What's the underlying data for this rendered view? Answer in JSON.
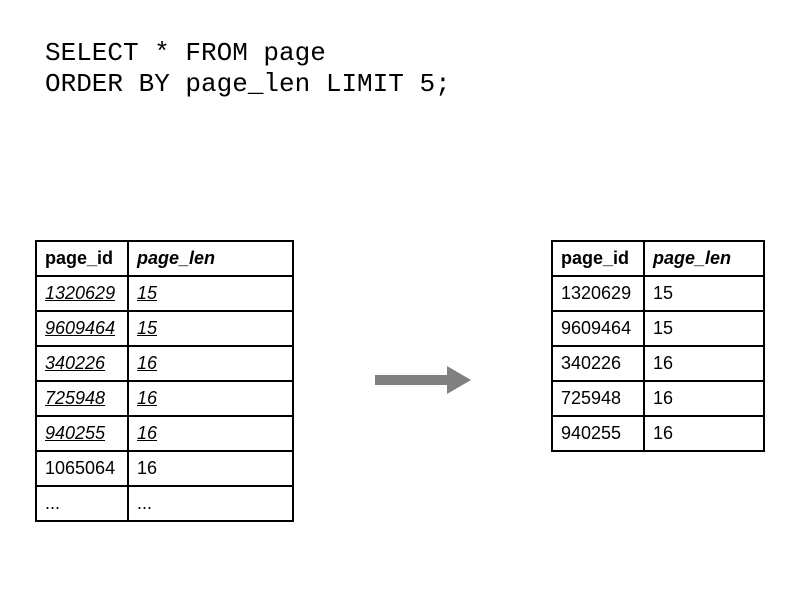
{
  "sql": {
    "line1": "SELECT * FROM page",
    "line2": "ORDER BY page_len LIMIT 5;"
  },
  "left_table": {
    "headers": {
      "id": "page_id",
      "len": "page_len"
    },
    "rows": [
      {
        "id": "1320629",
        "len": "15",
        "hl": true
      },
      {
        "id": "9609464",
        "len": "15",
        "hl": true
      },
      {
        "id": "340226",
        "len": "16",
        "hl": true
      },
      {
        "id": "725948",
        "len": "16",
        "hl": true
      },
      {
        "id": "940255",
        "len": "16",
        "hl": true
      },
      {
        "id": "1065064",
        "len": "16",
        "hl": false
      },
      {
        "id": "...",
        "len": "...",
        "hl": false
      }
    ]
  },
  "right_table": {
    "headers": {
      "id": "page_id",
      "len": "page_len"
    },
    "rows": [
      {
        "id": "1320629",
        "len": "15"
      },
      {
        "id": "9609464",
        "len": "15"
      },
      {
        "id": "340226",
        "len": "16"
      },
      {
        "id": "725948",
        "len": "16"
      },
      {
        "id": "940255",
        "len": "16"
      }
    ]
  },
  "chart_data": {
    "type": "table",
    "title": "SQL LIMIT illustration: source rows vs. result rows",
    "query": "SELECT * FROM page ORDER BY page_len LIMIT 5;",
    "source_rows": [
      {
        "page_id": 1320629,
        "page_len": 15
      },
      {
        "page_id": 9609464,
        "page_len": 15
      },
      {
        "page_id": 340226,
        "page_len": 16
      },
      {
        "page_id": 725948,
        "page_len": 16
      },
      {
        "page_id": 940255,
        "page_len": 16
      },
      {
        "page_id": 1065064,
        "page_len": 16
      }
    ],
    "source_truncated": true,
    "result_rows": [
      {
        "page_id": 1320629,
        "page_len": 15
      },
      {
        "page_id": 9609464,
        "page_len": 15
      },
      {
        "page_id": 340226,
        "page_len": 16
      },
      {
        "page_id": 725948,
        "page_len": 16
      },
      {
        "page_id": 940255,
        "page_len": 16
      }
    ]
  }
}
